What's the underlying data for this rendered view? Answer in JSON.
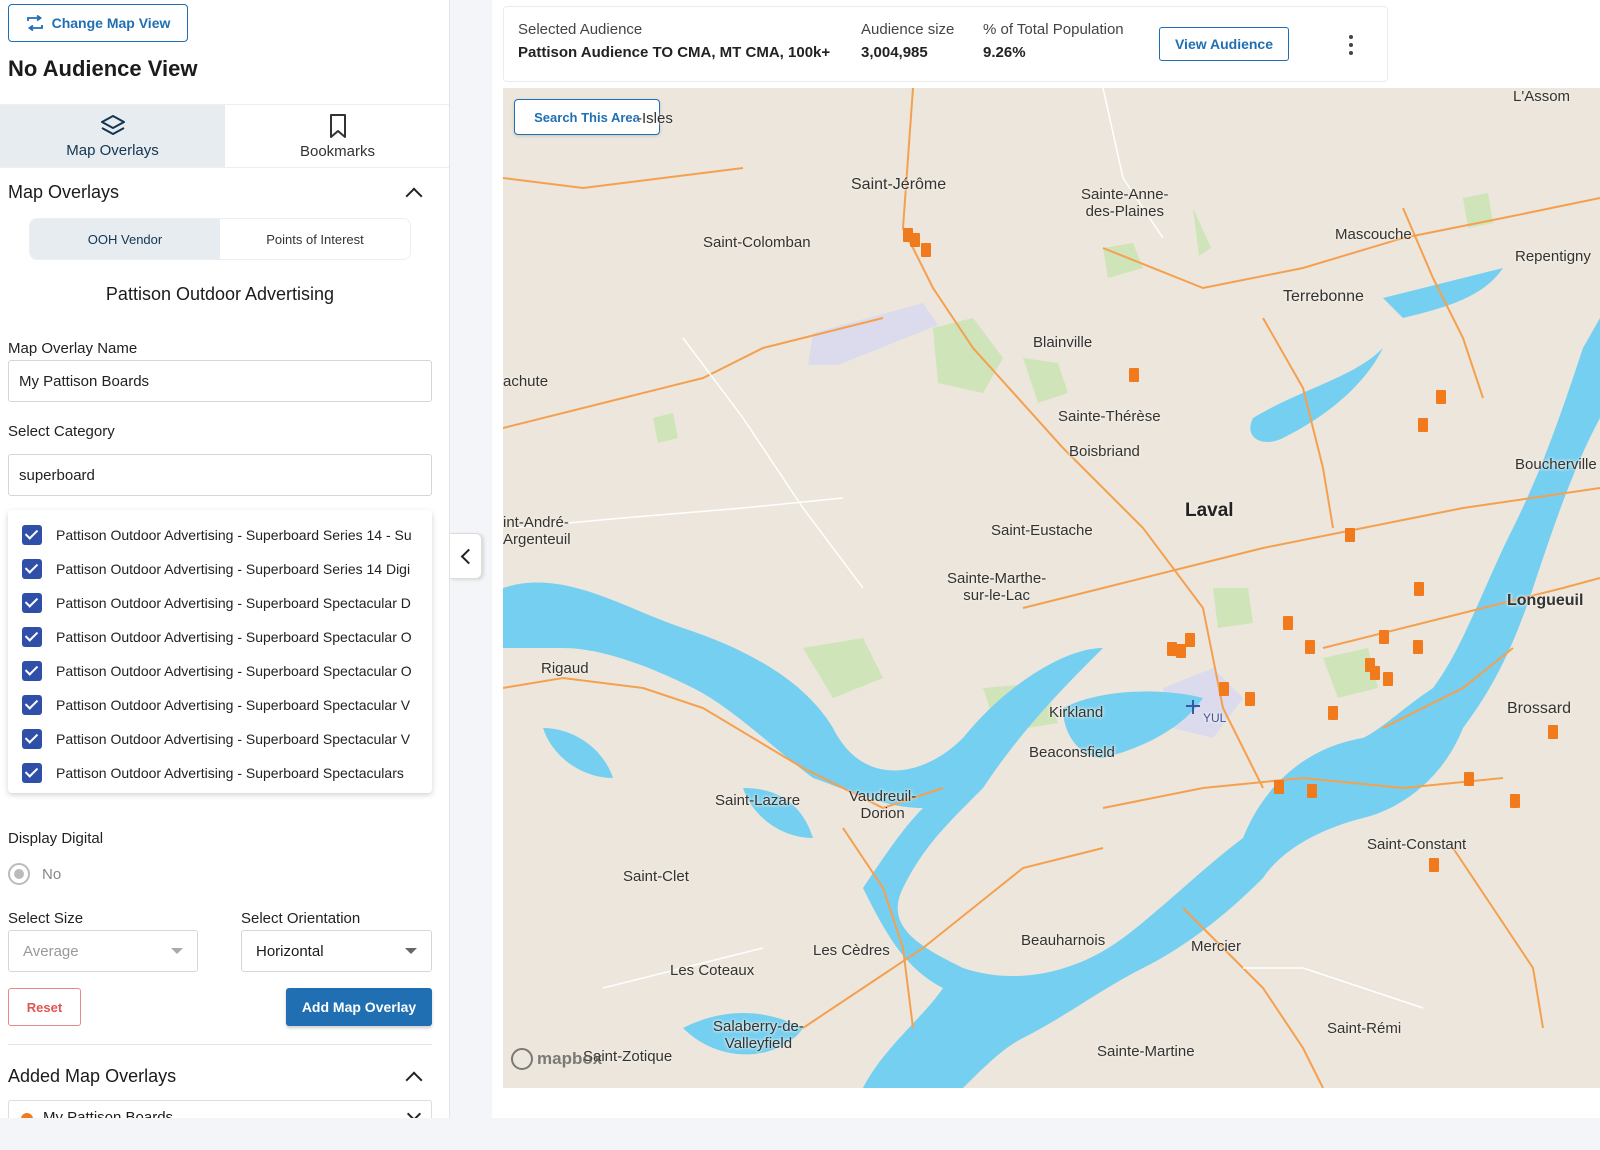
{
  "header": {
    "change_map_view": "Change Map View",
    "title": "No Audience View"
  },
  "tabs": [
    {
      "label": "Map Overlays",
      "icon": "layers-icon",
      "active": true
    },
    {
      "label": "Bookmarks",
      "icon": "bookmark-icon",
      "active": false
    }
  ],
  "overlays": {
    "section_title": "Map Overlays",
    "segments": [
      "OOH Vendor",
      "Points of Interest"
    ],
    "vendor": "Pattison Outdoor Advertising",
    "name_label": "Map Overlay Name",
    "name_value": "My Pattison Boards",
    "category_label": "Select Category",
    "category_value": "superboard",
    "categories": [
      "Pattison Outdoor Advertising - Superboard Series 14 - Su",
      "Pattison Outdoor Advertising - Superboard Series 14 Digi",
      "Pattison Outdoor Advertising - Superboard Spectacular D",
      "Pattison Outdoor Advertising - Superboard Spectacular O",
      "Pattison Outdoor Advertising - Superboard Spectacular O",
      "Pattison Outdoor Advertising - Superboard Spectacular V",
      "Pattison Outdoor Advertising - Superboard Spectacular V",
      "Pattison Outdoor Advertising - Superboard Spectaculars"
    ],
    "display_digital_label": "Display Digital",
    "display_digital_value": "No",
    "size_label": "Select Size",
    "size_value": "Average",
    "orientation_label": "Select Orientation",
    "orientation_value": "Horizontal",
    "reset": "Reset",
    "add": "Add Map Overlay",
    "added_title": "Added Map Overlays",
    "added_item": "My Pattison Boards"
  },
  "audience": {
    "selected_label": "Selected Audience",
    "selected_value": "Pattison Audience TO CMA, MT CMA, 100k+",
    "size_label": "Audience size",
    "size_value": "3,004,985",
    "pct_label": "% of Total Population",
    "pct_value": "9.26%",
    "view_button": "View Audience"
  },
  "map": {
    "search_button": "Search This Area",
    "attribution": "mapbox",
    "marker_color": "#f07a1c",
    "water_color": "#75cff0",
    "road_color": "#f5a04e",
    "cities": {
      "c1": "Saint-Jérôme",
      "c2": "Sainte-Anne-\ndes-Plaines",
      "c3": "Saint-Colomban",
      "c4": "Mascouche",
      "c5": "Repentigny",
      "c6": "Terrebonne",
      "c7": "Blainville",
      "c8": "achute",
      "c9": "Sainte-Thérèse",
      "c10": "Boisbriand",
      "c11": "Boucherville",
      "c12": "Laval",
      "c13": "Saint-Eustache",
      "c14": "int-André-\nArgenteuil",
      "c15": "Sainte-Marthe-\nsur-le-Lac",
      "c16": "Longueuil",
      "c17": "Rigaud",
      "c18": "Kirkland",
      "c19": "Brossard",
      "c20": "Beaconsfield",
      "c21": "Saint-Lazare",
      "c22": "Vaudreuil-\nDorion",
      "c23": "Saint-Constant",
      "c24": "Saint-Clet",
      "c25": "Beauharnois",
      "c26": "Mercier",
      "c27": "Les Cèdres",
      "c28": "Les Coteaux",
      "c29": "Salaberry-de-\nValleyfield",
      "c30": "Saint-Rémi",
      "c31": "Saint-Zotique",
      "c32": "Sainte-Martine",
      "c33": "L'Assom",
      "c34": "-Isles",
      "c35": "YUL"
    }
  }
}
